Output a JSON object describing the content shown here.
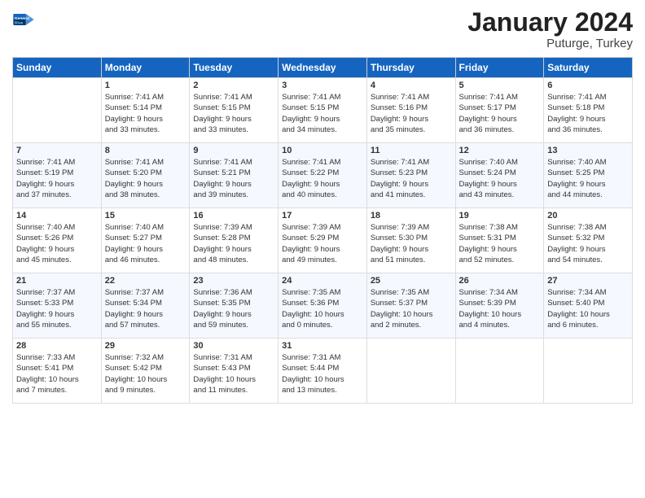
{
  "header": {
    "logo_line1": "General",
    "logo_line2": "Blue",
    "month_title": "January 2024",
    "subtitle": "Puturge, Turkey"
  },
  "weekdays": [
    "Sunday",
    "Monday",
    "Tuesday",
    "Wednesday",
    "Thursday",
    "Friday",
    "Saturday"
  ],
  "weeks": [
    [
      {
        "day": "",
        "info": ""
      },
      {
        "day": "1",
        "info": "Sunrise: 7:41 AM\nSunset: 5:14 PM\nDaylight: 9 hours\nand 33 minutes."
      },
      {
        "day": "2",
        "info": "Sunrise: 7:41 AM\nSunset: 5:15 PM\nDaylight: 9 hours\nand 33 minutes."
      },
      {
        "day": "3",
        "info": "Sunrise: 7:41 AM\nSunset: 5:15 PM\nDaylight: 9 hours\nand 34 minutes."
      },
      {
        "day": "4",
        "info": "Sunrise: 7:41 AM\nSunset: 5:16 PM\nDaylight: 9 hours\nand 35 minutes."
      },
      {
        "day": "5",
        "info": "Sunrise: 7:41 AM\nSunset: 5:17 PM\nDaylight: 9 hours\nand 36 minutes."
      },
      {
        "day": "6",
        "info": "Sunrise: 7:41 AM\nSunset: 5:18 PM\nDaylight: 9 hours\nand 36 minutes."
      }
    ],
    [
      {
        "day": "7",
        "info": "Sunrise: 7:41 AM\nSunset: 5:19 PM\nDaylight: 9 hours\nand 37 minutes."
      },
      {
        "day": "8",
        "info": "Sunrise: 7:41 AM\nSunset: 5:20 PM\nDaylight: 9 hours\nand 38 minutes."
      },
      {
        "day": "9",
        "info": "Sunrise: 7:41 AM\nSunset: 5:21 PM\nDaylight: 9 hours\nand 39 minutes."
      },
      {
        "day": "10",
        "info": "Sunrise: 7:41 AM\nSunset: 5:22 PM\nDaylight: 9 hours\nand 40 minutes."
      },
      {
        "day": "11",
        "info": "Sunrise: 7:41 AM\nSunset: 5:23 PM\nDaylight: 9 hours\nand 41 minutes."
      },
      {
        "day": "12",
        "info": "Sunrise: 7:40 AM\nSunset: 5:24 PM\nDaylight: 9 hours\nand 43 minutes."
      },
      {
        "day": "13",
        "info": "Sunrise: 7:40 AM\nSunset: 5:25 PM\nDaylight: 9 hours\nand 44 minutes."
      }
    ],
    [
      {
        "day": "14",
        "info": "Sunrise: 7:40 AM\nSunset: 5:26 PM\nDaylight: 9 hours\nand 45 minutes."
      },
      {
        "day": "15",
        "info": "Sunrise: 7:40 AM\nSunset: 5:27 PM\nDaylight: 9 hours\nand 46 minutes."
      },
      {
        "day": "16",
        "info": "Sunrise: 7:39 AM\nSunset: 5:28 PM\nDaylight: 9 hours\nand 48 minutes."
      },
      {
        "day": "17",
        "info": "Sunrise: 7:39 AM\nSunset: 5:29 PM\nDaylight: 9 hours\nand 49 minutes."
      },
      {
        "day": "18",
        "info": "Sunrise: 7:39 AM\nSunset: 5:30 PM\nDaylight: 9 hours\nand 51 minutes."
      },
      {
        "day": "19",
        "info": "Sunrise: 7:38 AM\nSunset: 5:31 PM\nDaylight: 9 hours\nand 52 minutes."
      },
      {
        "day": "20",
        "info": "Sunrise: 7:38 AM\nSunset: 5:32 PM\nDaylight: 9 hours\nand 54 minutes."
      }
    ],
    [
      {
        "day": "21",
        "info": "Sunrise: 7:37 AM\nSunset: 5:33 PM\nDaylight: 9 hours\nand 55 minutes."
      },
      {
        "day": "22",
        "info": "Sunrise: 7:37 AM\nSunset: 5:34 PM\nDaylight: 9 hours\nand 57 minutes."
      },
      {
        "day": "23",
        "info": "Sunrise: 7:36 AM\nSunset: 5:35 PM\nDaylight: 9 hours\nand 59 minutes."
      },
      {
        "day": "24",
        "info": "Sunrise: 7:35 AM\nSunset: 5:36 PM\nDaylight: 10 hours\nand 0 minutes."
      },
      {
        "day": "25",
        "info": "Sunrise: 7:35 AM\nSunset: 5:37 PM\nDaylight: 10 hours\nand 2 minutes."
      },
      {
        "day": "26",
        "info": "Sunrise: 7:34 AM\nSunset: 5:39 PM\nDaylight: 10 hours\nand 4 minutes."
      },
      {
        "day": "27",
        "info": "Sunrise: 7:34 AM\nSunset: 5:40 PM\nDaylight: 10 hours\nand 6 minutes."
      }
    ],
    [
      {
        "day": "28",
        "info": "Sunrise: 7:33 AM\nSunset: 5:41 PM\nDaylight: 10 hours\nand 7 minutes."
      },
      {
        "day": "29",
        "info": "Sunrise: 7:32 AM\nSunset: 5:42 PM\nDaylight: 10 hours\nand 9 minutes."
      },
      {
        "day": "30",
        "info": "Sunrise: 7:31 AM\nSunset: 5:43 PM\nDaylight: 10 hours\nand 11 minutes."
      },
      {
        "day": "31",
        "info": "Sunrise: 7:31 AM\nSunset: 5:44 PM\nDaylight: 10 hours\nand 13 minutes."
      },
      {
        "day": "",
        "info": ""
      },
      {
        "day": "",
        "info": ""
      },
      {
        "day": "",
        "info": ""
      }
    ]
  ]
}
